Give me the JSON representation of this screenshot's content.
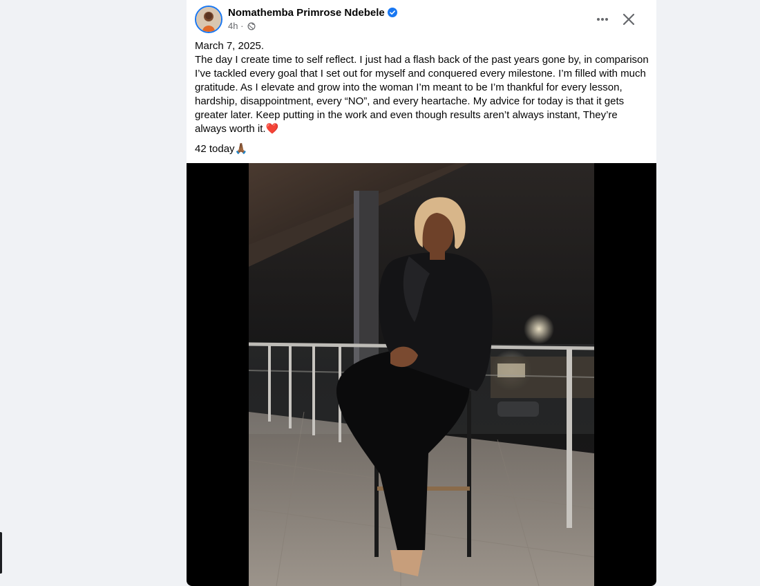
{
  "post": {
    "author": "Nomathemba Primrose Ndebele",
    "verified": true,
    "time": "4h",
    "separator": "·",
    "audience_icon": "globe-icon",
    "date_line": "March 7, 2025.",
    "text": "The day I create time to self reflect. I just had a flash back of the past years gone by, in comparison I’ve tackled every goal that I set out for myself and conquered every milestone. I’m filled with much gratitude. As I elevate and grow into the woman I’m meant to be I’m thankful for every lesson, hardship, disappointment, every “NO”, and every heartache. My advice for today is that it gets greater later. Keep putting in the work and even though results aren’t always instant, They’re always worth it.",
    "text_emoji": "❤️",
    "tail": "42 today",
    "tail_emoji": "🙏🏾"
  },
  "header_actions": {
    "more_icon": "more-horizontal-icon",
    "close_icon": "close-icon"
  },
  "colors": {
    "accent": "#1877f2",
    "secondary_text": "#65676b",
    "page_background": "#f0f2f5",
    "heart": "#e41e3f"
  }
}
